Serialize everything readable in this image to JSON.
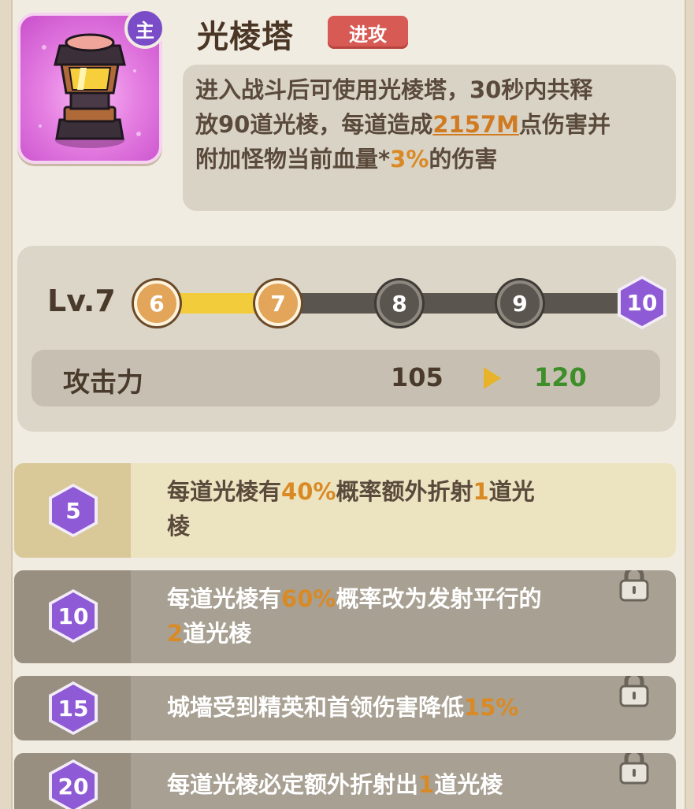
{
  "header": {
    "title": "光棱塔",
    "tag": "进攻",
    "main_badge": "主",
    "description": {
      "line1": "进入战斗后可使用光棱塔，30秒内共释",
      "line2_a": "放90道光棱，每道造成",
      "line2_damage": "2157M",
      "line2_b": "点伤害并",
      "line3_a": "附加怪物当前血量*",
      "line3_pct": "3%",
      "line3_b": "的伤害"
    }
  },
  "level": {
    "label": "Lv.7",
    "progress": 0.25,
    "nodes": [
      "6",
      "7",
      "8",
      "9",
      "10"
    ],
    "stat": {
      "name": "攻击力",
      "current": "105",
      "next": "120"
    }
  },
  "skills": [
    {
      "level": "5",
      "locked": false,
      "line1_a": "每道光棱有",
      "line1_pct": "40%",
      "line1_b": "概率额外折射",
      "line1_num": "1",
      "line1_c": "道光",
      "line2": "棱"
    },
    {
      "level": "10",
      "locked": true,
      "line1_a": "每道光棱有",
      "line1_pct": "60%",
      "line1_b": "概率改为发射平行的",
      "line2_num": "2",
      "line2_b": "道光棱"
    },
    {
      "level": "15",
      "locked": true,
      "line1_a": "城墙受到精英和首领伤害降低",
      "line1_pct": "15%"
    },
    {
      "level": "20",
      "locked": true,
      "line1_a": "每道光棱必定额外折射出",
      "line1_num": "1",
      "line1_b": "道光棱"
    }
  ],
  "colors": {
    "accent_orange": "#d98a25",
    "stat_up_green": "#3e8e2a",
    "progress_yellow": "#f3cc3c",
    "badge_purple": "#8f5ad6",
    "tag_red": "#d85a54"
  },
  "icons": {
    "tower": "prism-tower-icon",
    "lock": "lock-icon",
    "arrow": "play-arrow-icon"
  }
}
